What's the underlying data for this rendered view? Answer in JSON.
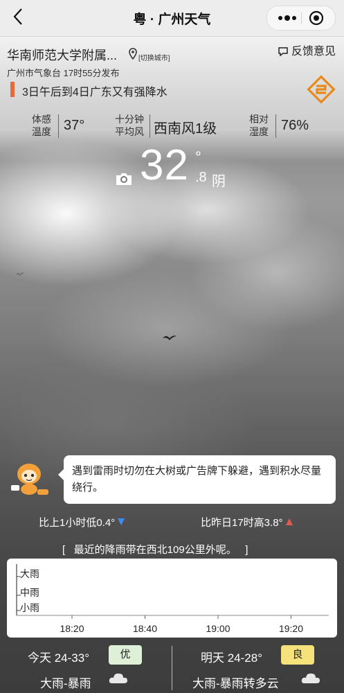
{
  "nav": {
    "title": "粤 · 广州天气",
    "back_icon": "chevron-left-icon",
    "more_icon": "more-dots-icon",
    "close_icon": "mini-program-close-icon"
  },
  "location": {
    "name": "华南师范大学附属...",
    "switch_label": "[切换城市]",
    "feedback": "反馈意见",
    "publish": "广州市气象台 17时55分发布"
  },
  "warning": {
    "text": "3日午后到4日广东又有强降水",
    "color": "#e86a3c"
  },
  "metrics": {
    "feels_label_1": "体感",
    "feels_label_2": "温度",
    "feels_value": "37°",
    "wind_label_1": "十分钟",
    "wind_label_2": "平均风",
    "wind_value": "西南风1级",
    "humidity_label_1": "相对",
    "humidity_label_2": "湿度",
    "humidity_value": "76%"
  },
  "current": {
    "temp_int": "32",
    "deg": "°",
    "temp_dec": ".8",
    "condition": "阴"
  },
  "tip": {
    "text": "遇到雷雨时切勿在大树或广告牌下躲避，遇到积水尽量绕行。"
  },
  "compare": {
    "last_hour": "比上1小时低0.4°",
    "yesterday": "比昨日17时高3.8°"
  },
  "rain_message": "[   最近的降雨带在西北109公里外呢。   ]",
  "chart_data": {
    "type": "line",
    "y_levels": [
      "大雨",
      "中雨",
      "小雨"
    ],
    "x_ticks": [
      "18:20",
      "18:40",
      "19:00",
      "19:20"
    ],
    "series": [
      {
        "values": []
      }
    ]
  },
  "forecast": {
    "today_temp": "今天 24-33°",
    "today_aqi": "优",
    "today_aqi_color": "#dff0d8",
    "today_weather": "大雨-暴雨",
    "tomorrow_temp": "明天 24-28°",
    "tomorrow_aqi": "良",
    "tomorrow_aqi_color": "#f6e27a",
    "tomorrow_weather": "大雨-暴雨转多云"
  }
}
